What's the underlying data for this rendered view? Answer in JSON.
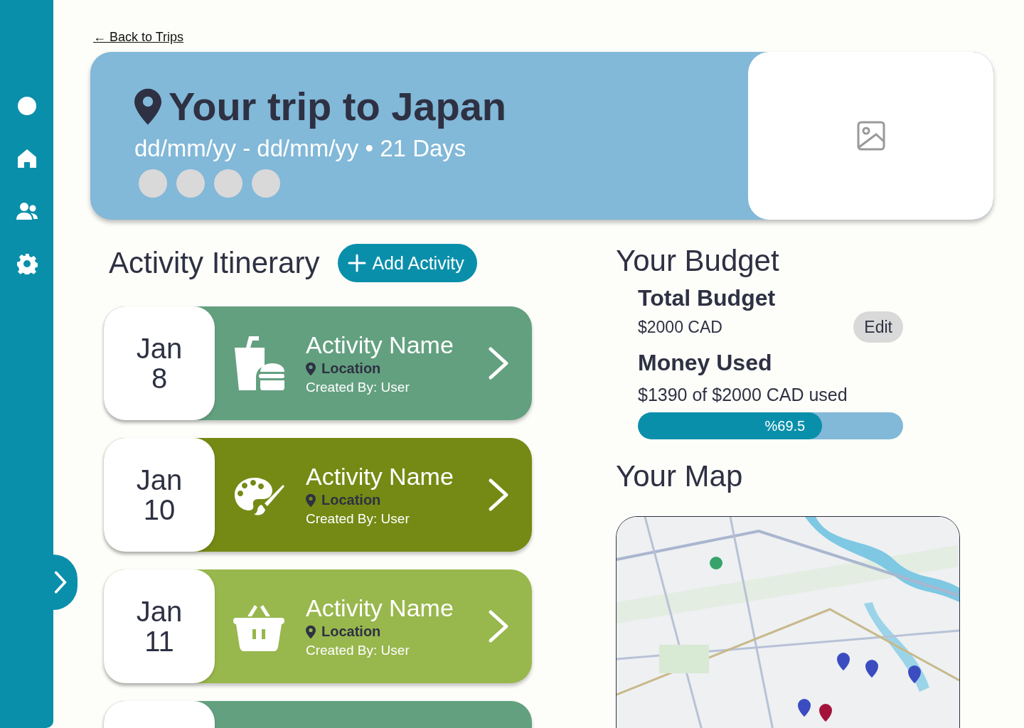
{
  "back_link": "← Back to Trips",
  "sidebar": {
    "items": [
      {
        "kind": "circle"
      },
      {
        "kind": "home"
      },
      {
        "kind": "users"
      },
      {
        "kind": "settings"
      }
    ]
  },
  "header": {
    "title": "Your trip to Japan",
    "subtitle": "dd/mm/yy - dd/mm/yy • 21 Days",
    "members": [
      {
        "kind": "avatar"
      },
      {
        "kind": "avatar"
      },
      {
        "kind": "avatar"
      },
      {
        "kind": "avatar"
      }
    ]
  },
  "itinerary": {
    "title": "Activity Itinerary",
    "add_button": "Add Activity",
    "activities": [
      {
        "month": "Jan",
        "day": "8",
        "name": "Activity Name",
        "location": "Location",
        "created_by": "Created By: User",
        "kind": "food",
        "color": "#63a07f"
      },
      {
        "month": "Jan",
        "day": "10",
        "name": "Activity Name",
        "location": "Location",
        "created_by": "Created By: User",
        "kind": "art",
        "color": "#748a14"
      },
      {
        "month": "Jan",
        "day": "11",
        "name": "Activity Name",
        "location": "Location",
        "created_by": "Created By: User",
        "kind": "shopping",
        "color": "#98b74d"
      },
      {
        "color": "#63a07f"
      }
    ]
  },
  "budget": {
    "title": "Your Budget",
    "total_label": "Total Budget",
    "total_value": "$2000 CAD",
    "edit_button": "Edit",
    "used_label": "Money Used",
    "used_value": "$1390 of $2000 CAD used",
    "level": 0.695,
    "reading": "%69.5"
  },
  "map": {
    "title": "Your Map",
    "kind": "picture"
  }
}
